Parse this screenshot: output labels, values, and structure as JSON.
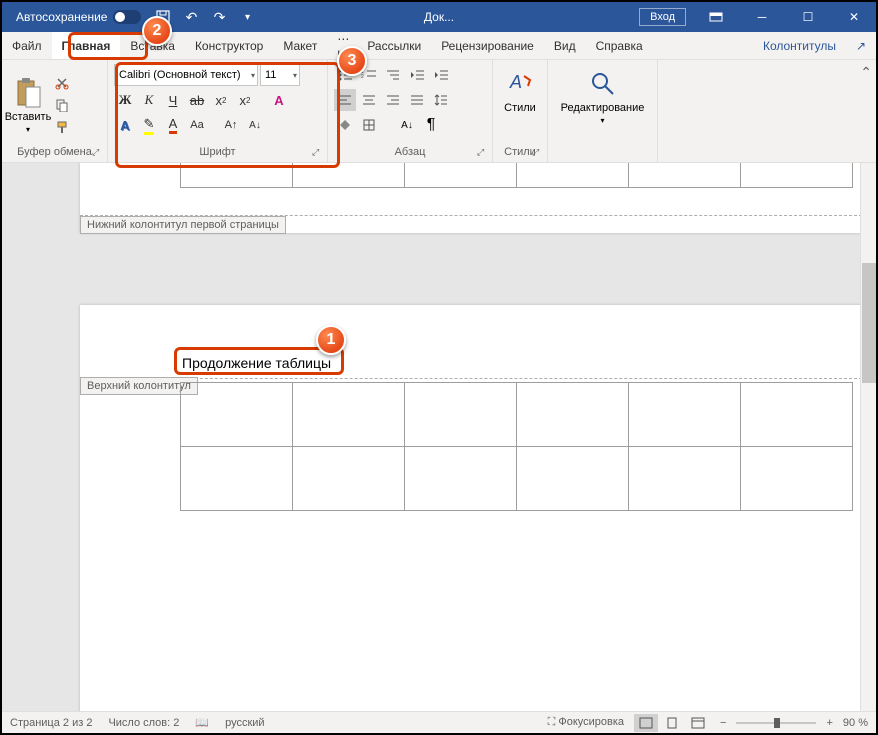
{
  "titlebar": {
    "autosave": "Автосохранение",
    "doc_title": "Док...",
    "login": "Вход"
  },
  "tabs": {
    "file": "Файл",
    "home": "Главная",
    "insert": "Вставка",
    "design": "Конструктор",
    "layout": "Макет",
    "references": "Ссылки",
    "mailings": "Рассылки",
    "review": "Рецензирование",
    "view": "Вид",
    "help": "Справка",
    "contextual": "Колонтитулы"
  },
  "ribbon": {
    "clipboard": {
      "label": "Буфер обмена",
      "paste": "Вставить"
    },
    "font": {
      "label": "Шрифт",
      "name": "Calibri (Основной текст)",
      "size": "11"
    },
    "paragraph": {
      "label": "Абзац"
    },
    "styles": {
      "label": "Стили",
      "btn": "Стили"
    },
    "editing": {
      "label": "Редактирование"
    }
  },
  "document": {
    "footer_tag": "Нижний колонтитул первой страницы",
    "header_tag": "Верхний колонтитул",
    "continuation": "Продолжение таблицы"
  },
  "statusbar": {
    "page": "Страница 2 из 2",
    "words": "Число слов: 2",
    "lang": "русский",
    "focus": "Фокусировка",
    "zoom": "90 %"
  },
  "callouts": {
    "c1": "1",
    "c2": "2",
    "c3": "3"
  }
}
